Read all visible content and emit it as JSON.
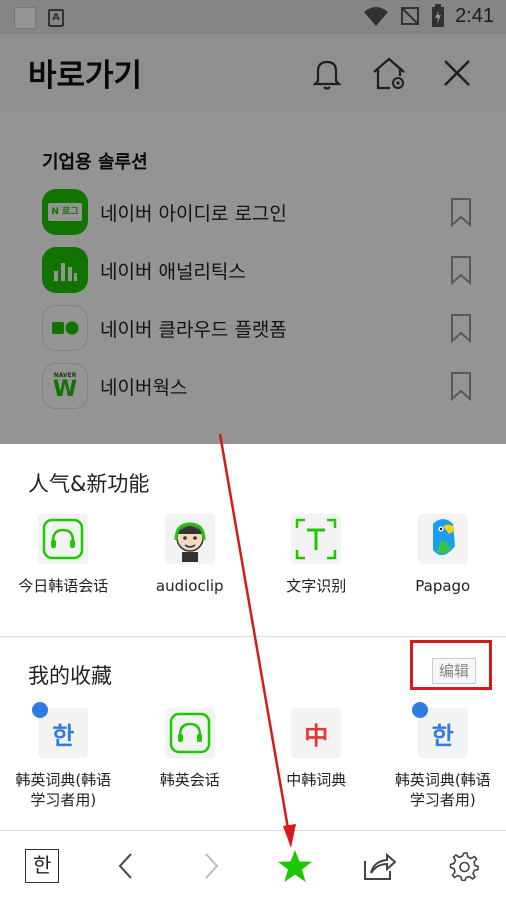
{
  "status_bar": {
    "time": "2:41"
  },
  "header": {
    "title": "바로가기"
  },
  "enterprise": {
    "title": "기업용 솔루션",
    "items": [
      {
        "label": "네이버 아이디로 로그인",
        "logo_text": "N 로그인",
        "logo_color": "#1ec800"
      },
      {
        "label": "네이버 애널리틱스",
        "logo_color": "#1ec800"
      },
      {
        "label": "네이버 클라우드 플랫폼",
        "logo_color": "#1ec800"
      },
      {
        "label": "네이버웍스",
        "logo_text": "NAVER",
        "logo_color": "#1ec800"
      }
    ]
  },
  "popular": {
    "title": "人气&新功能",
    "tiles": [
      {
        "label": "今日韩语会话",
        "icon": "chat-icon"
      },
      {
        "label": "audioclip",
        "icon": "audioclip-avatar-icon"
      },
      {
        "label": "文字识别",
        "icon": "text-scan-icon",
        "glyph": "T"
      },
      {
        "label": "Papago",
        "icon": "papago-parrot-icon"
      }
    ]
  },
  "favorites": {
    "title": "我的收藏",
    "edit_label": "编辑",
    "tiles": [
      {
        "label": "韩英词典(韩语学习者用)",
        "icon": "korean-dict-icon",
        "glyph": "한"
      },
      {
        "label": "韩英会话",
        "icon": "chat-icon"
      },
      {
        "label": "中韩词典",
        "icon": "chinese-dict-icon",
        "glyph": "中"
      },
      {
        "label": "韩英词典(韩语学习者用)",
        "icon": "korean-dict-icon",
        "glyph": "한"
      }
    ]
  },
  "bottom_nav": {
    "hangul_glyph": "한"
  },
  "colors": {
    "accent_green": "#1ec800",
    "highlight_red": "#d61a1a",
    "badge_blue": "#2f7de1"
  }
}
